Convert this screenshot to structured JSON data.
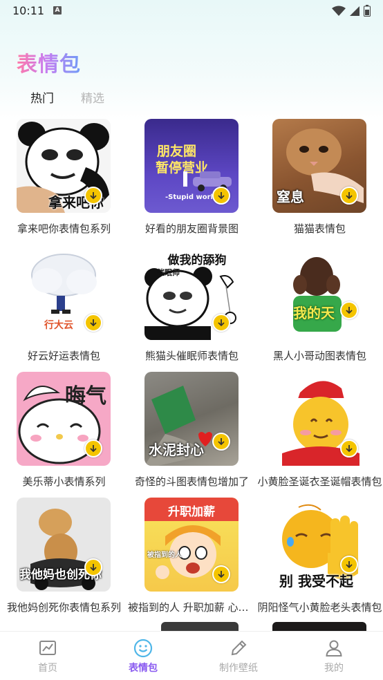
{
  "status_bar": {
    "time": "10:11",
    "indicator": "A"
  },
  "app": {
    "title": "表情包"
  },
  "tabs": [
    {
      "label": "热门",
      "active": true
    },
    {
      "label": "精选",
      "active": false
    }
  ],
  "items": [
    {
      "label": "拿来吧你表情包系列",
      "caption": "拿来吧你",
      "art": "panda-hand"
    },
    {
      "label": "好看的朋友圈背景图",
      "caption_line1": "朋友圈",
      "caption_line2": "暂停营业",
      "caption_small": "-Stupid world-",
      "art": "purple-car"
    },
    {
      "label": "猫猫表情包",
      "caption": "窒息",
      "art": "cat"
    },
    {
      "label": "好云好运表情包",
      "caption": "行大云",
      "art": "cloud"
    },
    {
      "label": "熊猫头催眠师表情包",
      "caption_top": "做我的舔狗",
      "caption_badge": "催眠师",
      "art": "panda-hypno"
    },
    {
      "label": "黑人小哥动图表情包",
      "caption": "我的天",
      "art": "green-guy"
    },
    {
      "label": "美乐蒂小表情系列",
      "caption": "晦气",
      "art": "melody"
    },
    {
      "label": "奇怪的斗图表情包增加了",
      "caption": "水泥封心",
      "art": "cement"
    },
    {
      "label": "小黄脸圣诞衣圣诞帽表情包",
      "art": "xmas-emoji"
    },
    {
      "label": "我他妈创死你表情包系列",
      "caption": "我他妈也创死你",
      "art": "doge-moto"
    },
    {
      "label": "被指到的人 升职加薪 心想事成",
      "caption_top": "升职加薪",
      "caption_small": "被指到的人",
      "art": "cartoon-girl"
    },
    {
      "label": "阴阳怪气小黄脸老头表情包",
      "caption": "别 我受不起",
      "art": "emoji-hand"
    }
  ],
  "bottom_nav": [
    {
      "label": "首页",
      "icon": "chart-icon",
      "active": false
    },
    {
      "label": "表情包",
      "icon": "smile-icon",
      "active": true
    },
    {
      "label": "制作壁纸",
      "icon": "pencil-icon",
      "active": false
    },
    {
      "label": "我的",
      "icon": "user-icon",
      "active": false
    }
  ],
  "colors": {
    "accent": "#8a5bf0",
    "download": "#f4c400"
  }
}
